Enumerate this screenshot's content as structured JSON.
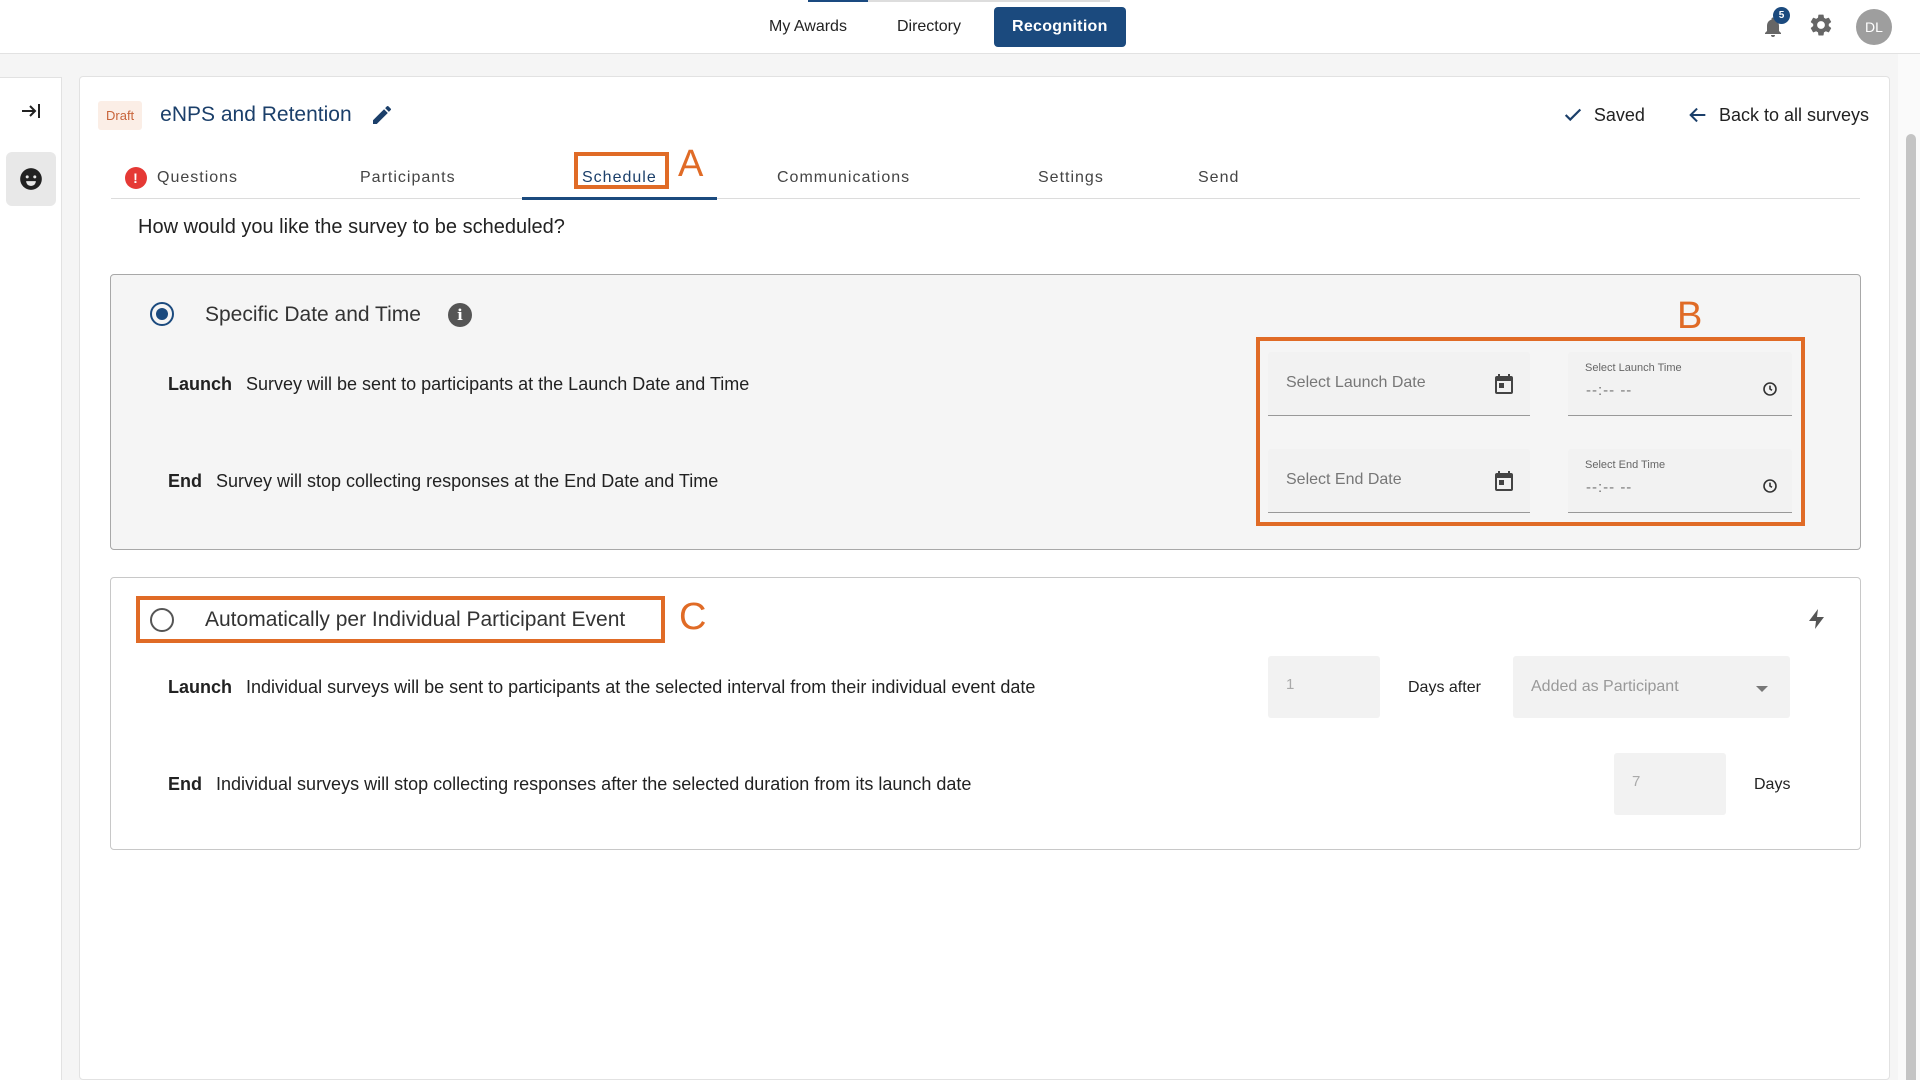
{
  "topnav": {
    "items": [
      {
        "label": "My Awards"
      },
      {
        "label": "Directory"
      },
      {
        "label": "Recognition"
      }
    ],
    "notification_count": "5",
    "avatar_initials": "DL"
  },
  "survey": {
    "status": "Draft",
    "title": "eNPS and Retention",
    "saved_label": "Saved",
    "back_label": "Back to all surveys"
  },
  "tabs": [
    {
      "label": "Questions"
    },
    {
      "label": "Participants"
    },
    {
      "label": "Schedule"
    },
    {
      "label": "Communications"
    },
    {
      "label": "Settings"
    },
    {
      "label": "Send"
    }
  ],
  "annotations": {
    "a": "A",
    "b": "B",
    "c": "C"
  },
  "schedule": {
    "question": "How would you like the survey to be scheduled?",
    "specific": {
      "title": "Specific Date and Time",
      "selected": true,
      "launch_label": "Launch",
      "launch_desc": "Survey will be sent to participants at the Launch Date and Time",
      "end_label": "End",
      "end_desc": "Survey will stop collecting responses at the End Date and Time",
      "launch_date_placeholder": "Select Launch Date",
      "launch_time_label": "Select Launch Time",
      "launch_time_value": "--:-- --",
      "end_date_placeholder": "Select End Date",
      "end_time_label": "Select End Time",
      "end_time_value": "--:-- --"
    },
    "automatic": {
      "title": "Automatically per Individual Participant Event",
      "selected": false,
      "launch_label": "Launch",
      "launch_desc": "Individual surveys will be sent to participants at the selected interval from their individual event date",
      "launch_days_value": "1",
      "days_after_label": "Days after",
      "event_select_value": "Added as Participant",
      "end_label": "End",
      "end_desc": "Individual surveys will stop collecting responses after the selected duration from its launch date",
      "end_days_value": "7",
      "days_label": "Days"
    }
  },
  "colors": {
    "primary": "#1b4a7e",
    "annotation": "#e06b26",
    "error": "#e53935"
  }
}
